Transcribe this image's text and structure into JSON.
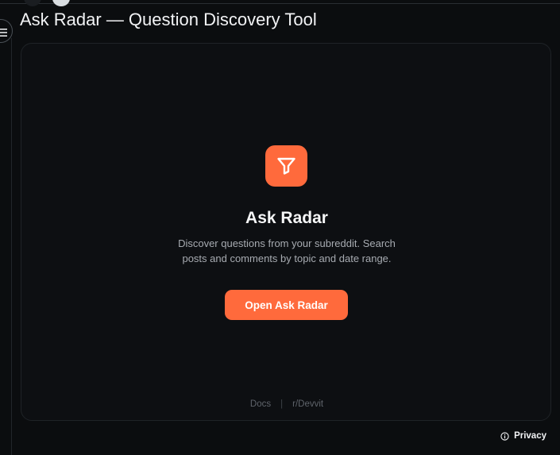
{
  "page": {
    "title": "Ask Radar — Question Discovery Tool"
  },
  "colors": {
    "accent": "#ff6a3c",
    "background": "#0b0d0f",
    "card": "#0d0f12"
  },
  "menu": {
    "icon": "hamburger-menu-icon"
  },
  "app_card": {
    "icon": "funnel-filter-icon",
    "name": "Ask Radar",
    "description": "Discover questions from your subreddit. Search posts and comments by topic and date range.",
    "button_label": "Open Ask Radar",
    "footer": {
      "docs_label": "Docs",
      "separator": "|",
      "community_label": "r/Devvit"
    }
  },
  "privacy": {
    "icon": "info-icon",
    "label": "Privacy"
  }
}
